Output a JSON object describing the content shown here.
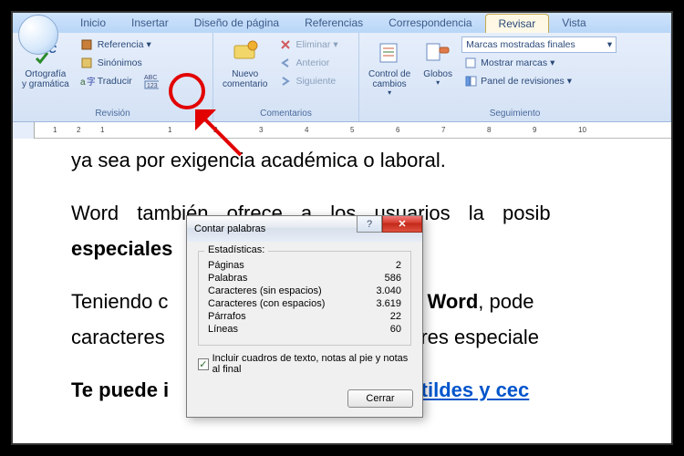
{
  "tabs": {
    "inicio": "Inicio",
    "insertar": "Insertar",
    "diseno": "Diseño de página",
    "referencias": "Referencias",
    "correspondencia": "Correspondencia",
    "revisar": "Revisar",
    "vista": "Vista"
  },
  "ribbon": {
    "proofing": {
      "label": "Revisión",
      "spell_label": "Ortografía\ny gramática",
      "referencia": "Referencia",
      "sinonimos": "Sinónimos",
      "traducir": "Traducir"
    },
    "comments": {
      "label": "Comentarios",
      "new_comment": "Nuevo\ncomentario",
      "delete": "Eliminar",
      "previous": "Anterior",
      "next": "Siguiente"
    },
    "tracking": {
      "label": "Seguimiento",
      "track_changes": "Control de\ncambios",
      "balloons": "Globos",
      "display_dropdown": "Marcas mostradas finales",
      "show_markup": "Mostrar marcas",
      "review_pane": "Panel de revisiones"
    }
  },
  "ruler": {
    "marks": [
      "1",
      "2",
      "1",
      "1",
      "2",
      "3",
      "4",
      "5",
      "6",
      "7",
      "8",
      "9",
      "10"
    ]
  },
  "document": {
    "line0": "ya sea por exigencia académica o laboral.",
    "line1a": "Word también ofrece a los usuarios la posib",
    "line1b": "especiales",
    "line2a": "Teniendo c",
    "line2b": "en Word",
    "line2c": ", pode",
    "line3a": "caracteres",
    "line3b": "teres especiale",
    "line4a": "Te puede i",
    "line4b": "bir tildes y cec"
  },
  "dialog": {
    "title": "Contar palabras",
    "legend": "Estadísticas:",
    "rows": [
      {
        "k": "Páginas",
        "v": "2"
      },
      {
        "k": "Palabras",
        "v": "586"
      },
      {
        "k": "Caracteres (sin espacios)",
        "v": "3.040"
      },
      {
        "k": "Caracteres (con espacios)",
        "v": "3.619"
      },
      {
        "k": "Párrafos",
        "v": "22"
      },
      {
        "k": "Líneas",
        "v": "60"
      }
    ],
    "checkbox_label": "Incluir cuadros de texto, notas al pie y notas al final",
    "checkbox_checked": true,
    "close_btn": "Cerrar"
  }
}
